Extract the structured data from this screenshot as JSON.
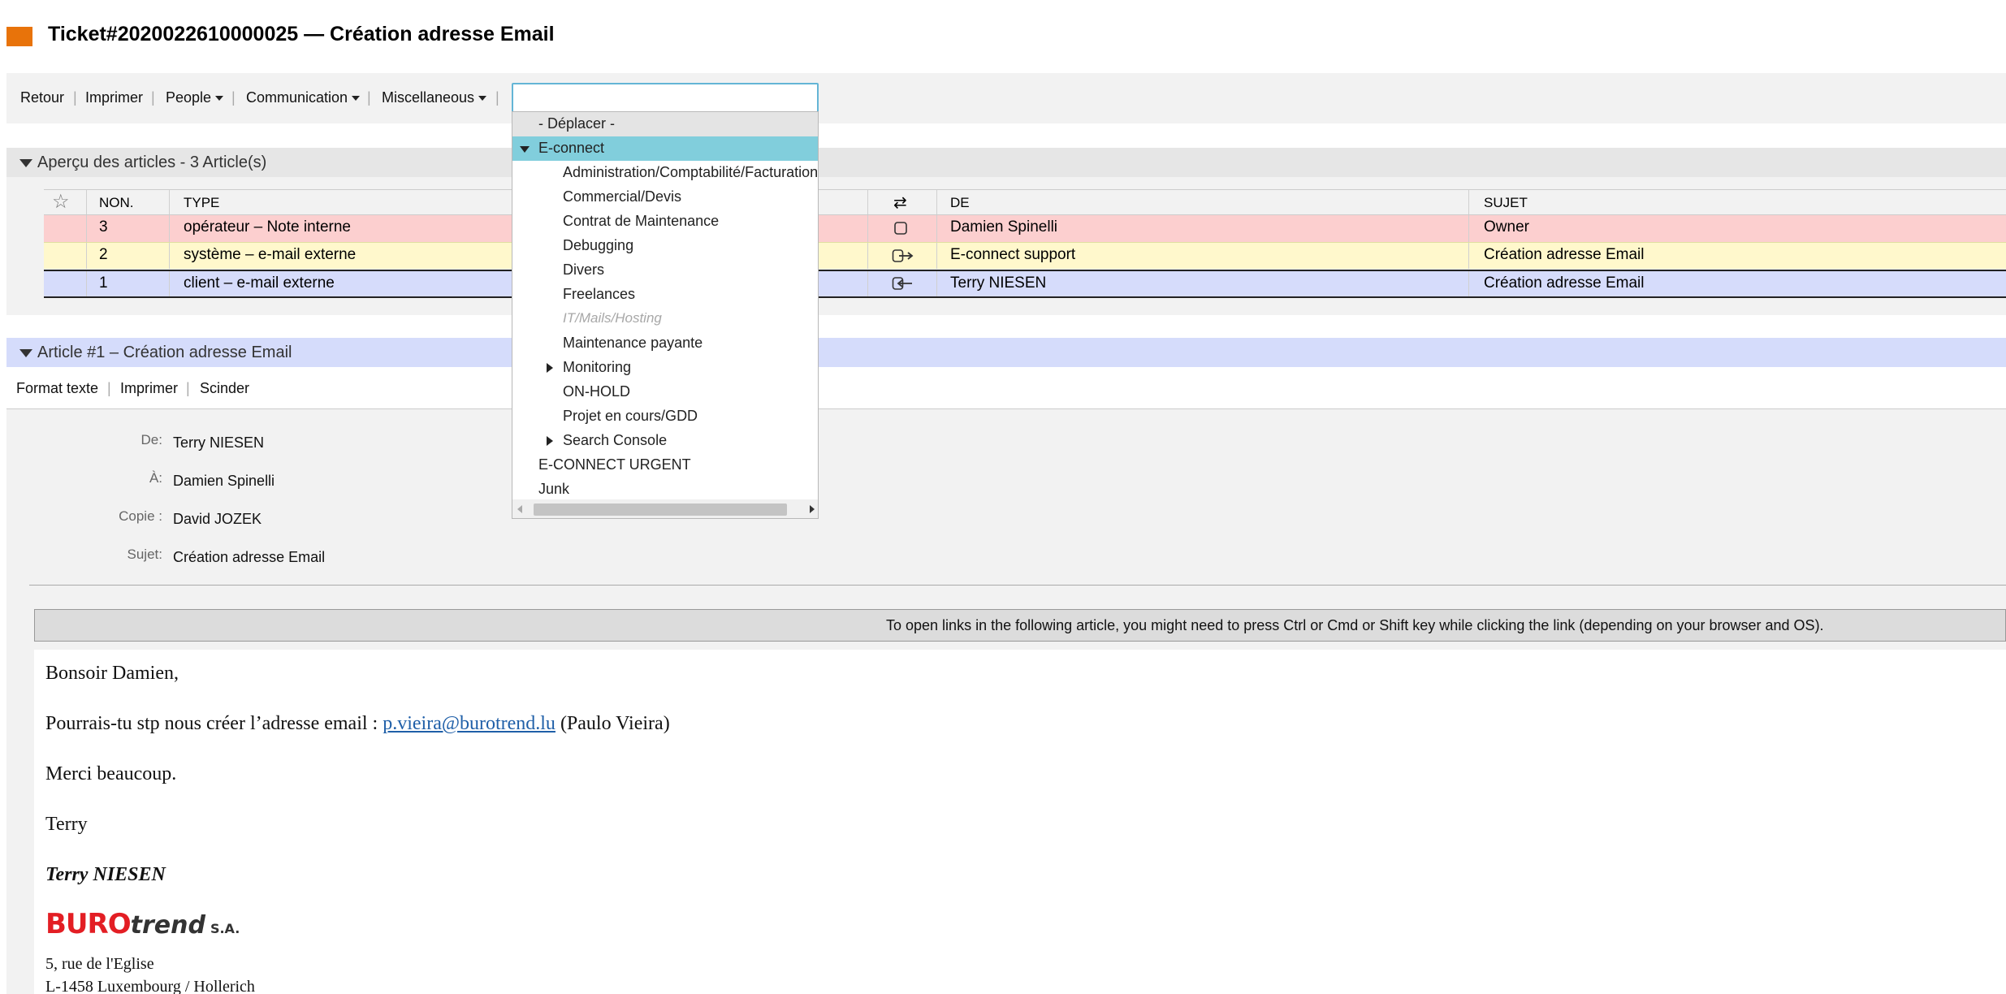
{
  "title": "Ticket#2020022610000025 — Création adresse Email",
  "colors": {
    "title_square": "#e8730a",
    "selected_row": "#fccfcf",
    "highlight_row": "#fff8cc",
    "active_row": "#d6dcfb",
    "dropdown_selected": "#81cedc",
    "article_header": "#d5dcfb"
  },
  "actions": {
    "back": "Retour",
    "print": "Imprimer",
    "people": "People",
    "communication": "Communication",
    "misc": "Miscellaneous"
  },
  "search": {
    "value": "",
    "placeholder": ""
  },
  "overview": {
    "heading": "Aperçu des articles - 3 Article(s)"
  },
  "table": {
    "headers": {
      "star": "☆",
      "no": "NON.",
      "type": "TYPE",
      "dir": "⇄",
      "from": "DE",
      "subject": "SUJET"
    },
    "rows": [
      {
        "no": "3",
        "type": "opérateur – Note interne",
        "dir_icon": "note-icon",
        "from": "Damien Spinelli",
        "subject": "Owner"
      },
      {
        "no": "2",
        "type": "système – e-mail externe",
        "dir_icon": "outgoing-icon",
        "from": "E-connect support",
        "subject": "Création adresse Email"
      },
      {
        "no": "1",
        "type": "client – e-mail externe",
        "dir_icon": "incoming-icon",
        "from": "Terry NIESEN",
        "subject": "Création adresse Email"
      }
    ]
  },
  "article": {
    "heading": "Article #1 – Création adresse Email",
    "actions": {
      "format": "Format texte",
      "print": "Imprimer",
      "split": "Scinder"
    },
    "meta": [
      {
        "label": "De:",
        "value": "Terry NIESEN"
      },
      {
        "label": "À:",
        "value": "Damien Spinelli"
      },
      {
        "label": "Copie :",
        "value": "David JOZEK"
      },
      {
        "label": "Sujet:",
        "value": "Création adresse Email"
      }
    ],
    "notice": "To open links in the following article, you might need to press Ctrl or Cmd or Shift key while clicking the link (depending on your browser and OS).",
    "body": {
      "greeting": "Bonsoir Damien,",
      "line1_prefix": "Pourrais-tu stp nous créer l’adresse email : ",
      "line1_link": "p.vieira@burotrend.lu",
      "line1_suffix": " (Paulo Vieira)",
      "thanks": "Merci beaucoup.",
      "sign": "Terry",
      "signature_name": "Terry NIESEN",
      "logo_text_1": "BURO",
      "logo_text_2": "trend",
      "logo_text_3": "S.A.",
      "address1": "5, rue de l'Eglise",
      "address2": "L-1458 Luxembourg / Hollerich"
    }
  },
  "dropdown": {
    "items": [
      {
        "label": "- Déplacer -",
        "level": 0
      },
      {
        "label": "E-connect",
        "level": 0,
        "expanded": true,
        "selected": true
      },
      {
        "label": "Administration/Comptabilité/Facturation",
        "level": 1
      },
      {
        "label": "Commercial/Devis",
        "level": 1
      },
      {
        "label": "Contrat de Maintenance",
        "level": 1
      },
      {
        "label": "Debugging",
        "level": 1
      },
      {
        "label": "Divers",
        "level": 1
      },
      {
        "label": "Freelances",
        "level": 1
      },
      {
        "label": "IT/Mails/Hosting",
        "level": 1,
        "disabled": true
      },
      {
        "label": "Maintenance payante",
        "level": 1
      },
      {
        "label": "Monitoring",
        "level": 1,
        "collapsed": true
      },
      {
        "label": "ON-HOLD",
        "level": 1
      },
      {
        "label": "Projet en cours/GDD",
        "level": 1
      },
      {
        "label": "Search Console",
        "level": 1,
        "collapsed": true
      },
      {
        "label": "E-CONNECT URGENT",
        "level": 0
      },
      {
        "label": "Junk",
        "level": 0
      }
    ]
  }
}
